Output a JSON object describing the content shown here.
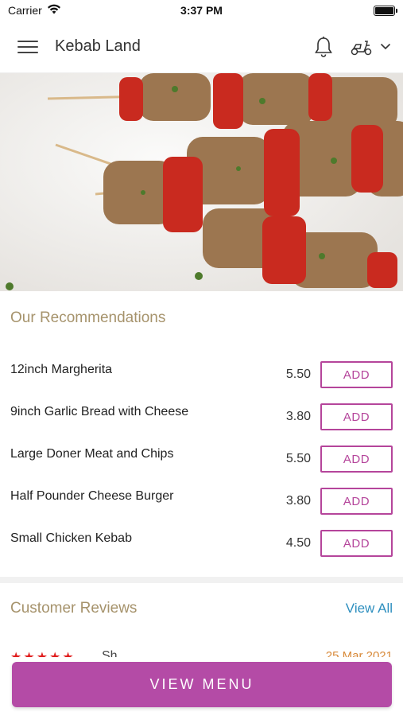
{
  "status_bar": {
    "carrier": "Carrier",
    "time": "3:37 PM"
  },
  "nav": {
    "title": "Kebab Land",
    "icons": [
      "menu-icon",
      "bell-icon",
      "scooter-icon",
      "chevron-down-icon"
    ]
  },
  "recommendations": {
    "title": "Our Recommendations",
    "add_label": "ADD",
    "items": [
      {
        "name": "12inch Margherita",
        "price": "5.50"
      },
      {
        "name": "9inch Garlic Bread with Cheese",
        "price": "3.80"
      },
      {
        "name": "Large Doner Meat and Chips",
        "price": "5.50"
      },
      {
        "name": "Half Pounder Cheese Burger",
        "price": "3.80"
      },
      {
        "name": "Small Chicken Kebab",
        "price": "4.50"
      }
    ]
  },
  "reviews": {
    "title": "Customer Reviews",
    "view_all": "View All",
    "first_rating": "★★★★★",
    "first_name": "Sh",
    "first_date": "25 Mar 2021"
  },
  "bottom": {
    "view_menu": "VIEW MENU"
  },
  "colors": {
    "accent": "#b44ba6",
    "section_title": "#a6936c",
    "link": "#2e8fbf",
    "star": "#e02020"
  }
}
